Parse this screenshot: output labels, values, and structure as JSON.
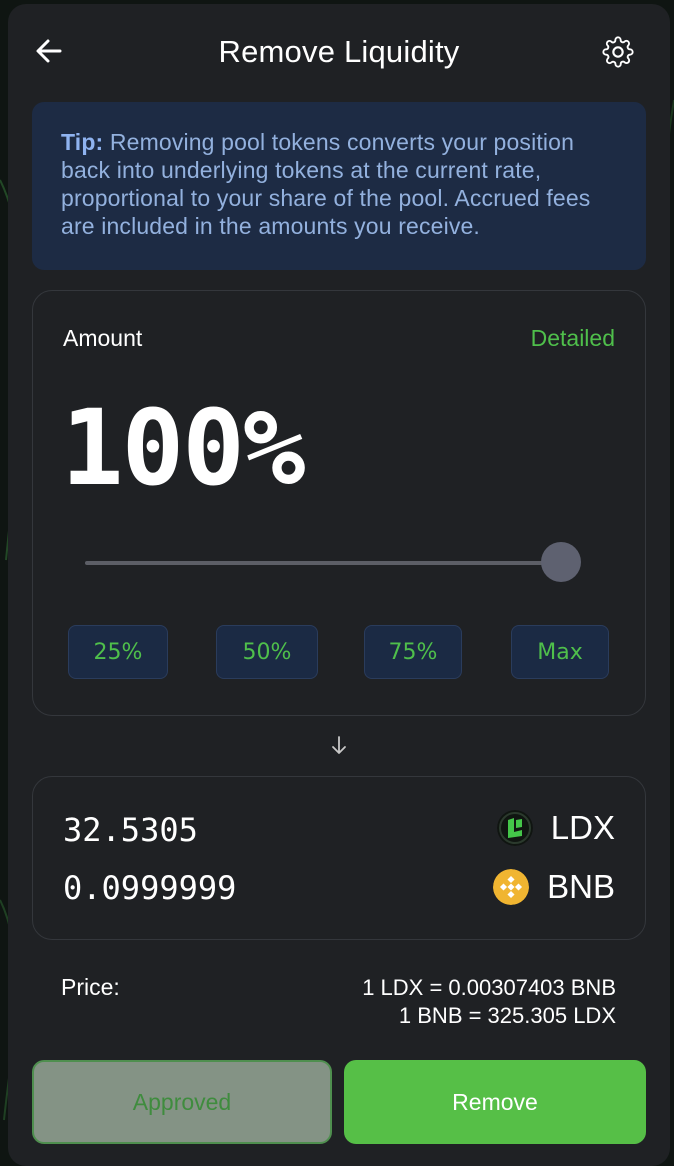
{
  "header": {
    "title": "Remove Liquidity",
    "back_icon": "arrow-left-icon",
    "settings_icon": "gear-icon"
  },
  "tip": {
    "prefix": "Tip:",
    "text": " Removing pool tokens converts your position back into underlying tokens at the current rate, proportional to your share of the pool. Accrued fees are included in the amounts you receive."
  },
  "amount": {
    "label": "Amount",
    "detailed_link": "Detailed",
    "percent_display": "100%",
    "slider_fraction": 1.0,
    "buttons": [
      "25%",
      "50%",
      "75%",
      "Max"
    ]
  },
  "output": {
    "tokens": [
      {
        "amount": "32.5305",
        "symbol": "LDX",
        "icon": "ldx-token-icon"
      },
      {
        "amount": "0.0999999",
        "symbol": "BNB",
        "icon": "bnb-token-icon"
      }
    ]
  },
  "price": {
    "label": "Price:",
    "line1": "1 LDX = 0.00307403 BNB",
    "line2": "1 BNB = 325.305 LDX"
  },
  "actions": {
    "approved_label": "Approved",
    "remove_label": "Remove"
  },
  "colors": {
    "accent_green": "#4fbf4b",
    "tip_bg": "#1d2b44",
    "card_bg": "#1f2124"
  }
}
